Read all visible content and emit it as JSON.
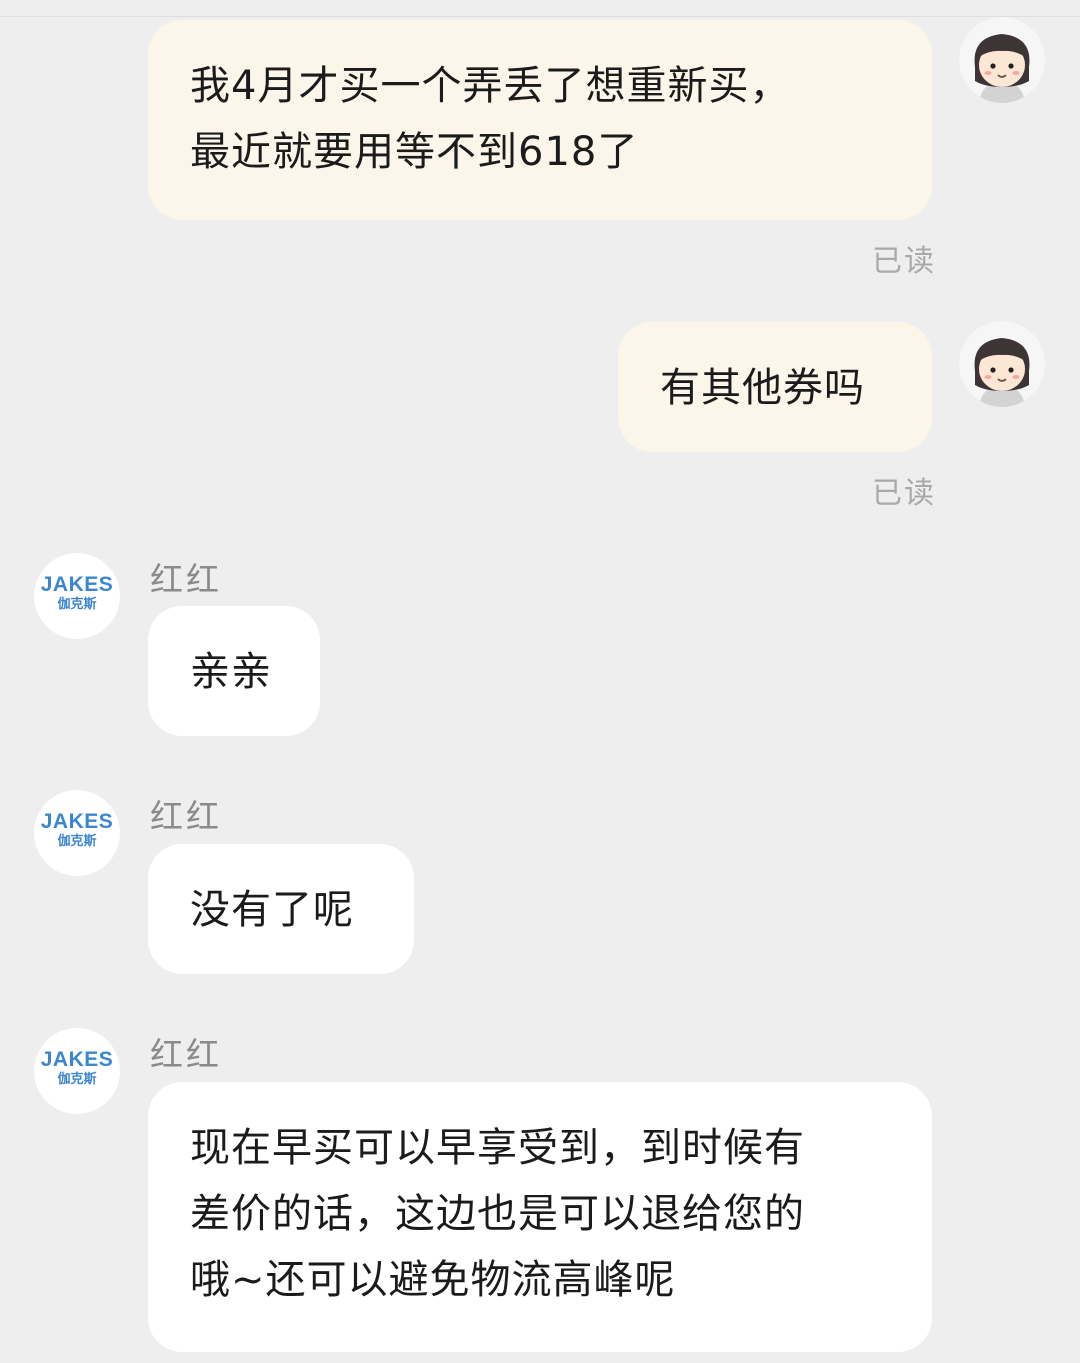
{
  "messages": [
    {
      "direction": "outgoing",
      "lines": [
        "我4月才买一个弄丢了想重新买，",
        "最近就要用等不到618了"
      ],
      "status": "已读"
    },
    {
      "direction": "outgoing",
      "lines": [
        "有其他券吗"
      ],
      "status": "已读"
    },
    {
      "direction": "incoming",
      "sender": "红红",
      "lines": [
        "亲亲"
      ]
    },
    {
      "direction": "incoming",
      "sender": "红红",
      "lines": [
        "没有了呢"
      ]
    },
    {
      "direction": "incoming",
      "sender": "红红",
      "lines": [
        "现在早买可以早享受到，到时候有",
        "差价的话，这边也是可以退给您的",
        "哦~还可以避免物流高峰呢"
      ]
    }
  ],
  "shop_avatar": {
    "brand_en": "JAKES",
    "brand_cn": "伽克斯",
    "color": "#3b86cf"
  },
  "colors": {
    "outgoing_bubble": "#fcf5e9",
    "incoming_bubble": "#ffffff",
    "background": "#eeeeee"
  },
  "icons": {
    "user_avatar": "cartoon-girl-avatar-icon"
  }
}
